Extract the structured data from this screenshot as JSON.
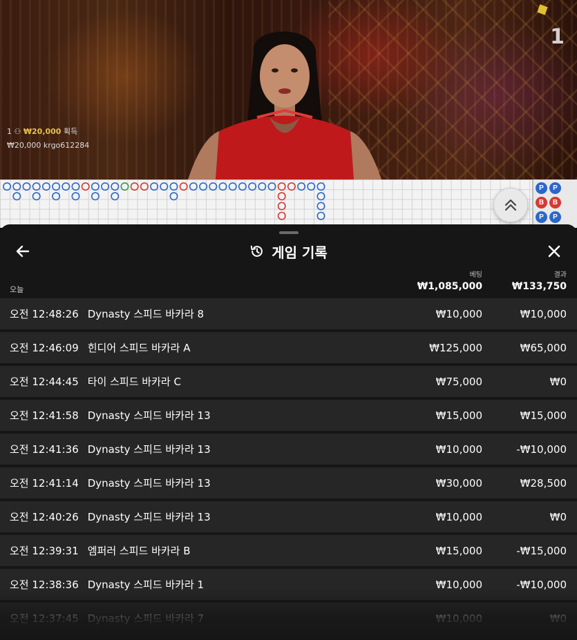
{
  "video": {
    "round_number": "1",
    "win_notice": {
      "count": "1",
      "amount": "₩20,000",
      "suffix": "획득"
    },
    "winner": {
      "amount": "₩20,000",
      "username": "krgo612284"
    }
  },
  "road_side": [
    "P",
    "P",
    "B",
    "B",
    "P",
    "P"
  ],
  "history": {
    "title": "게임 기록",
    "section_label": "오늘",
    "bet_label": "베팅",
    "result_label": "결과",
    "bet_total": "₩1,085,000",
    "result_total": "₩133,750",
    "rows": [
      {
        "time": "오전 12:48:26",
        "game": "Dynasty 스피드 바카라 8",
        "bet": "₩10,000",
        "result": "₩10,000"
      },
      {
        "time": "오전 12:46:09",
        "game": "힌디어 스피드 바카라 A",
        "bet": "₩125,000",
        "result": "₩65,000"
      },
      {
        "time": "오전 12:44:45",
        "game": "타이 스피드 바카라 C",
        "bet": "₩75,000",
        "result": "₩0"
      },
      {
        "time": "오전 12:41:58",
        "game": "Dynasty 스피드 바카라 13",
        "bet": "₩15,000",
        "result": "₩15,000"
      },
      {
        "time": "오전 12:41:36",
        "game": "Dynasty 스피드 바카라 13",
        "bet": "₩10,000",
        "result": "-₩10,000"
      },
      {
        "time": "오전 12:41:14",
        "game": "Dynasty 스피드 바카라 13",
        "bet": "₩30,000",
        "result": "₩28,500"
      },
      {
        "time": "오전 12:40:26",
        "game": "Dynasty 스피드 바카라 13",
        "bet": "₩10,000",
        "result": "₩0"
      },
      {
        "time": "오전 12:39:31",
        "game": "엠퍼러 스피드 바카라 B",
        "bet": "₩15,000",
        "result": "-₩15,000"
      },
      {
        "time": "오전 12:38:36",
        "game": "Dynasty 스피드 바카라 1",
        "bet": "₩10,000",
        "result": "-₩10,000"
      },
      {
        "time": "오전 12:37:45",
        "game": "Dynasty 스피드 바카라 7",
        "bet": "₩10,000",
        "result": "₩0"
      }
    ]
  },
  "icons": {
    "back": "arrow-left-icon",
    "close": "close-icon",
    "history": "history-icon",
    "road_toggle": "chevron-double-up-icon"
  },
  "colors": {
    "banker": "#d43a32",
    "player": "#2b67c9",
    "tie": "#2e9e3e",
    "win_gold": "#e6c14a"
  }
}
